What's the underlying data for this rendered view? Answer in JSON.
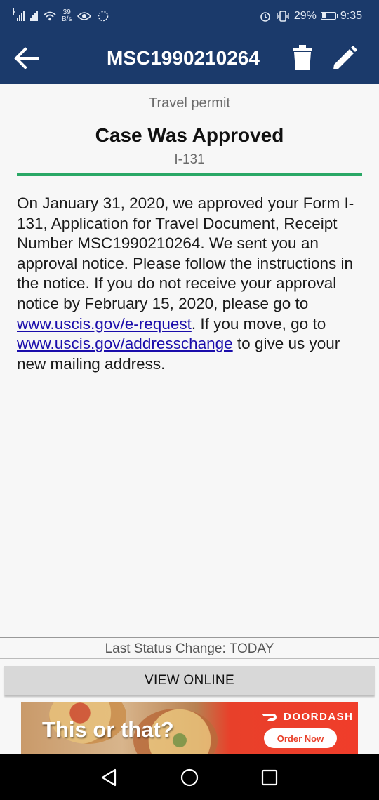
{
  "status_bar": {
    "net_speed_value": "39",
    "net_speed_unit": "B/s",
    "battery": "29%",
    "time": "9:35"
  },
  "toolbar": {
    "title": "MSC1990210264"
  },
  "case": {
    "permit_type": "Travel permit",
    "status": "Case Was Approved",
    "form": "I-131",
    "desc_part1": "On January 31, 2020, we approved your Form I-131, Application for Travel Document, Receipt Number MSC1990210264. We sent you an approval notice. Please follow the instructions in the notice. If you do not receive your approval notice by February 15, 2020, please go to ",
    "link1": "www.uscis.gov/e-request",
    "desc_part2": ". If you move, go to ",
    "link2": "www.uscis.gov/addresschange",
    "desc_part3": " to give us your new mailing address."
  },
  "footer": {
    "last_status": "Last Status Change: TODAY",
    "view_online": "VIEW ONLINE"
  },
  "ad": {
    "headline": "This or that?",
    "brand": "DOORDASH",
    "cta": "Order Now"
  },
  "colors": {
    "header": "#1b3a6b",
    "accent_bar": "#2aa866",
    "link": "#1a0dab",
    "ad_red": "#f03d2a"
  }
}
